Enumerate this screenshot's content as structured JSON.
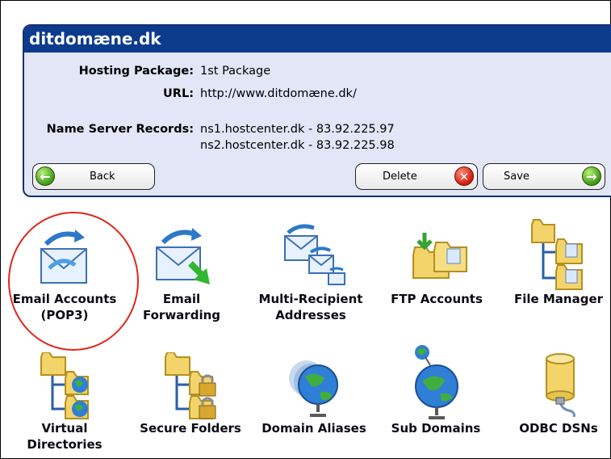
{
  "domain_panel": {
    "title": "ditdomæne.dk",
    "hosting_package_label": "Hosting Package:",
    "hosting_package_value": "1st Package",
    "url_label": "URL:",
    "url_value": "http://www.ditdomæne.dk/",
    "name_server_label": "Name Server Records:",
    "name_servers": [
      "ns1.hostcenter.dk - 83.92.225.97",
      "ns2.hostcenter.dk - 83.92.225.98"
    ],
    "buttons": {
      "back": "Back",
      "delete": "Delete",
      "save": "Save"
    }
  },
  "icons": [
    {
      "label": "Email Accounts\n(POP3)",
      "icon": "email-accounts-icon"
    },
    {
      "label": "Email\nForwarding",
      "icon": "email-forwarding-icon"
    },
    {
      "label": "Multi-Recipient\nAddresses",
      "icon": "multi-recipient-icon"
    },
    {
      "label": "FTP Accounts",
      "icon": "ftp-accounts-icon"
    },
    {
      "label": "File Manager",
      "icon": "file-manager-icon"
    },
    {
      "label": "Virtual\nDirectories",
      "icon": "virtual-directories-icon"
    },
    {
      "label": "Secure Folders",
      "icon": "secure-folders-icon"
    },
    {
      "label": "Domain Aliases",
      "icon": "domain-aliases-icon"
    },
    {
      "label": "Sub Domains",
      "icon": "sub-domains-icon"
    },
    {
      "label": "ODBC DSNs",
      "icon": "odbc-dsns-icon"
    }
  ],
  "colors": {
    "panel_header": "#0d3b8c",
    "panel_body": "#e2e6f7",
    "highlight_circle": "#e0261c"
  }
}
